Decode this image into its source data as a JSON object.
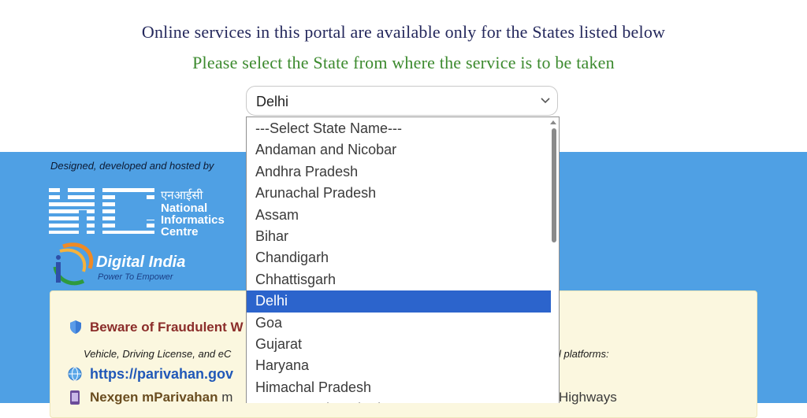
{
  "header": {
    "line1": "Online services in this portal are available only for the States listed below",
    "line2": "Please select the State from where the service is to be taken"
  },
  "state_select": {
    "value": "Delhi",
    "icon": "chevron-down-icon"
  },
  "dropdown": {
    "options": [
      "---Select State Name---",
      "Andaman and Nicobar",
      "Andhra Pradesh",
      "Arunachal Pradesh",
      "Assam",
      "Bihar",
      "Chandigarh",
      "Chhattisgarh",
      "Delhi",
      "Goa",
      "Gujarat",
      "Haryana",
      "Himachal Pradesh",
      "Jammu and Kashmir"
    ],
    "selected_index": 8
  },
  "footer": {
    "designed_by": "Designed, developed and hosted by",
    "nic_hindi": "एनआईसी",
    "nic_name_1": "National",
    "nic_name_2": "Informatics",
    "nic_name_3": "Centre",
    "nic_abbrev": "NIC",
    "digital_india": "Digital India",
    "digital_india_tagline": "Power To Empower"
  },
  "notice": {
    "beware": "Beware of Fraudulent W",
    "info": "Vehicle, Driving License, and eC",
    "info_tail": "l platforms:",
    "link": "https://parivahan.gov",
    "nexgen": "Nexgen mParivahan",
    "nexgen_suffix": "m",
    "nexgen_tail": "Highways"
  },
  "colors": {
    "footer_bg": "#4fa0e4",
    "selected_bg": "#2c64cc",
    "heading_blue": "#24285c",
    "heading_green": "#3c8a2e"
  }
}
